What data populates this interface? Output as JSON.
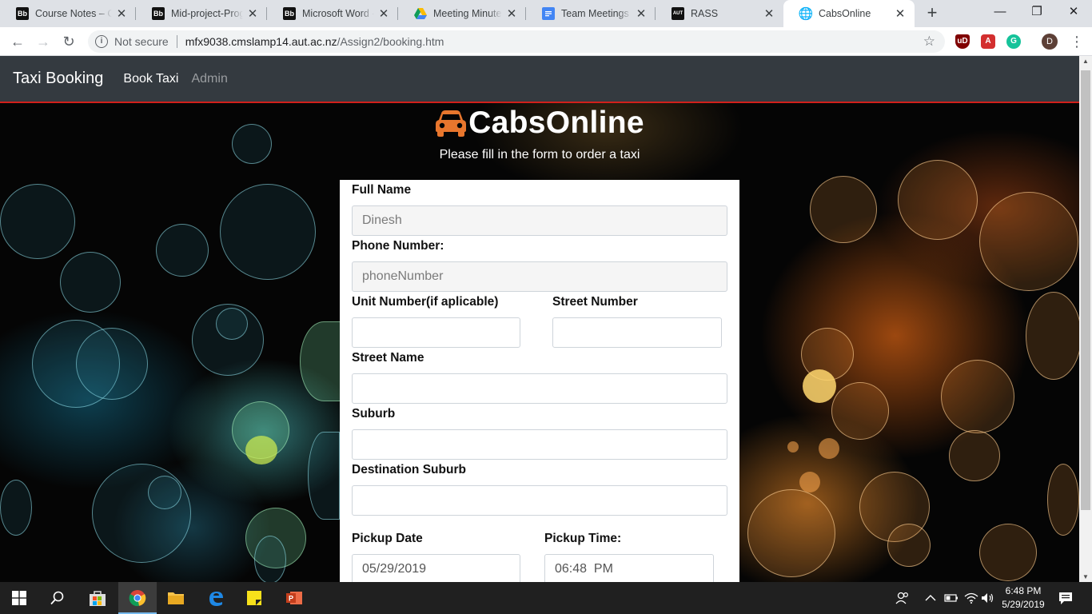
{
  "browser": {
    "tabs": [
      {
        "title": "Course Notes – CC",
        "favicon": "blackboard-icon",
        "fav_text": "Bb"
      },
      {
        "title": "Mid-project-Progr",
        "favicon": "blackboard-icon",
        "fav_text": "Bb"
      },
      {
        "title": "Microsoft Word - V",
        "favicon": "blackboard-icon",
        "fav_text": "Bb"
      },
      {
        "title": "Meeting Minutes -",
        "favicon": "google-drive-icon",
        "fav_text": ""
      },
      {
        "title": "Team Meetings - C",
        "favicon": "google-docs-icon",
        "fav_text": ""
      },
      {
        "title": "RASS",
        "favicon": "aut-icon",
        "fav_text": "AUT"
      },
      {
        "title": "CabsOnline",
        "favicon": "globe-icon",
        "fav_text": "🌐",
        "active": true
      }
    ],
    "address": {
      "security": "Not secure",
      "host": "mfx9038.cmslamp14.aut.ac.nz",
      "path": "/Assign2/booking.htm"
    },
    "profile_initial": "D"
  },
  "site": {
    "brand": "Taxi Booking",
    "nav": [
      "Book Taxi",
      "Admin"
    ],
    "heading": "CabsOnline",
    "subheading": "Please fill in the form to order a taxi"
  },
  "form": {
    "full_name": {
      "label": "Full Name",
      "placeholder": "Dinesh",
      "value": ""
    },
    "phone": {
      "label": "Phone Number:",
      "placeholder": "phoneNumber",
      "value": ""
    },
    "unit": {
      "label": "Unit Number(if aplicable)",
      "value": ""
    },
    "street_number": {
      "label": "Street Number",
      "value": ""
    },
    "street_name": {
      "label": "Street Name",
      "value": ""
    },
    "suburb": {
      "label": "Suburb",
      "value": ""
    },
    "destination": {
      "label": "Destination Suburb",
      "value": ""
    },
    "pickup_date": {
      "label": "Pickup Date",
      "value": "05/29/2019"
    },
    "pickup_time": {
      "label": "Pickup Time:",
      "value": "06:48  PM"
    }
  },
  "taskbar": {
    "time": "6:48 PM",
    "date": "5/29/2019"
  },
  "colors": {
    "navbar": "#343a40",
    "navbar_border": "#d1201b",
    "car_icon": "#e8762d"
  }
}
